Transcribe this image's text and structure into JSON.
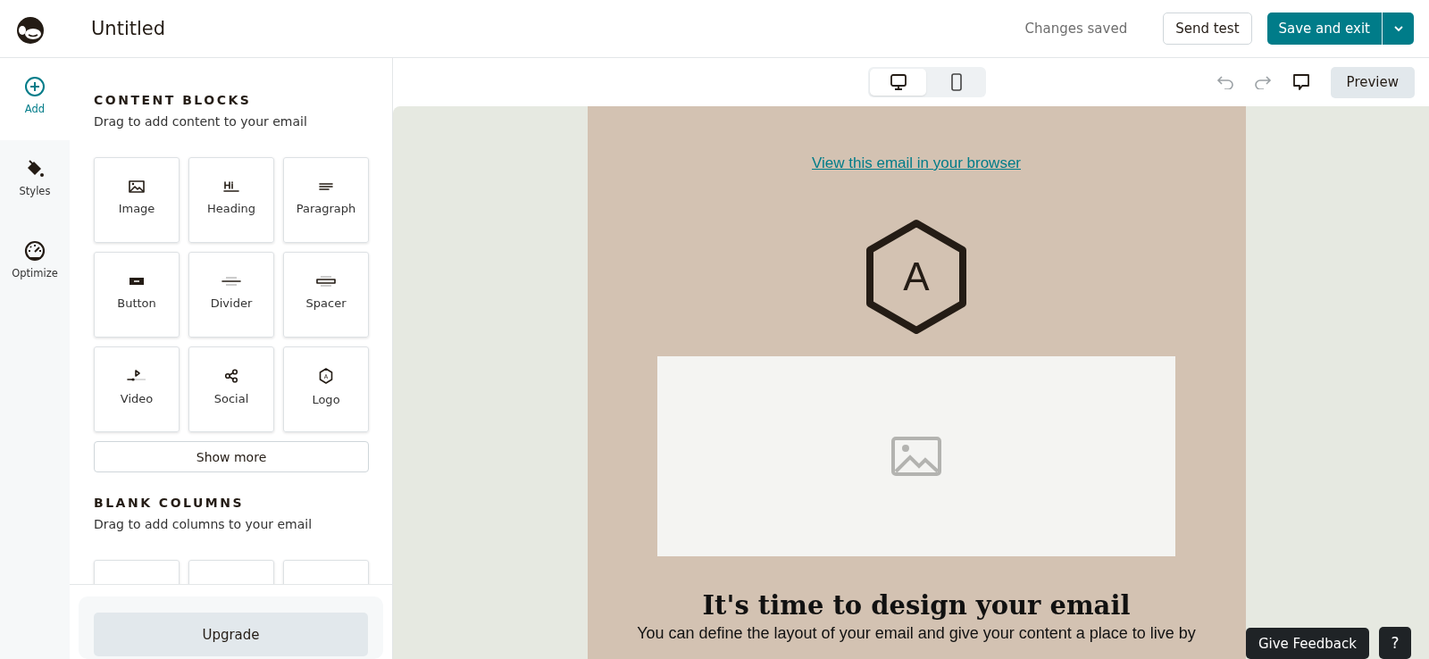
{
  "header": {
    "title": "Untitled",
    "status": "Changes saved",
    "buttons": [
      {
        "label": "Send test",
        "kind": "secondary"
      },
      {
        "label": "Save and exit",
        "kind": "primary"
      }
    ]
  },
  "rail": [
    {
      "label": "Add",
      "kind": "add",
      "selected": true
    },
    {
      "label": "Styles",
      "kind": "bucket",
      "selected": false
    },
    {
      "label": "Optimize",
      "kind": "gauge",
      "selected": false
    }
  ],
  "panel": {
    "sections": [
      {
        "title": "CONTENT BLOCKS",
        "subtitle": "Drag to add content to your email",
        "blocks": [
          {
            "label": "Image",
            "kind": "image"
          },
          {
            "label": "Heading",
            "kind": "heading"
          },
          {
            "label": "Paragraph",
            "kind": "paragraph"
          },
          {
            "label": "Button",
            "kind": "button"
          },
          {
            "label": "Divider",
            "kind": "divider"
          },
          {
            "label": "Spacer",
            "kind": "spacer"
          },
          {
            "label": "Video",
            "kind": "video"
          },
          {
            "label": "Social",
            "kind": "social"
          },
          {
            "label": "Logo",
            "kind": "logo",
            "icon_text": "A"
          }
        ],
        "more": "Show more"
      },
      {
        "title": "BLANK COLUMNS",
        "subtitle": "Drag to add columns to your email"
      }
    ],
    "upgrade": "Upgrade"
  },
  "toolbar": {
    "views": [
      {
        "kind": "desktop",
        "selected": true
      },
      {
        "kind": "mobile",
        "selected": false
      }
    ],
    "preview": "Preview"
  },
  "email": {
    "link": "View this email in your browser",
    "logo_letter": "A",
    "heading": "It's time to design your email",
    "body": "You can define the layout of your email and give your content a place to live by"
  },
  "footer": {
    "feedback": "Give Feedback",
    "help": "?"
  }
}
